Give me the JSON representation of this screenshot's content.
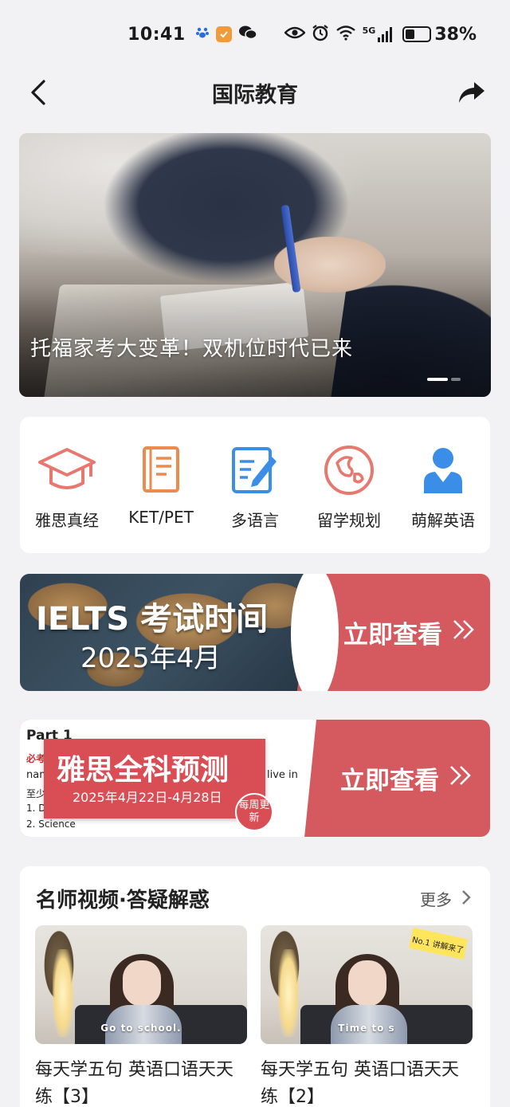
{
  "status_bar": {
    "time": "10:41",
    "network": "5G",
    "battery": "38%",
    "battery_level": 0.38
  },
  "nav": {
    "title": "国际教育"
  },
  "hero": {
    "caption": "托福家考大变革！双机位时代已来",
    "slide_count": 2,
    "active_slide": 1
  },
  "categories": [
    {
      "label": "雅思真经",
      "icon": "graduation-cap-icon",
      "color": "#e7786f"
    },
    {
      "label": "KET/PET",
      "icon": "book-icon",
      "color": "#ec8b4e"
    },
    {
      "label": "多语言",
      "icon": "edit-document-icon",
      "color": "#3a8ee8"
    },
    {
      "label": "留学规划",
      "icon": "globe-icon",
      "color": "#e7786f"
    },
    {
      "label": "萌解英语",
      "icon": "person-icon",
      "color": "#3a8ee8"
    }
  ],
  "promo_ielts": {
    "title": "IELTS 考试时间",
    "subtitle": "2025年4月",
    "cta": "立即查看",
    "cta_arrow": "»"
  },
  "promo_forecast": {
    "paper_heading": "Part 1",
    "paper_line1": "必考",
    "paper_line2": "nam",
    "paper_line2_right": "live in",
    "paper_line3": "至少",
    "paper_line4": "1. D",
    "paper_line5": "2. Science",
    "title": "雅思全科预测",
    "dates": "2025年4月22日-4月28日",
    "badge": "每周更新",
    "cta": "立即查看",
    "cta_arrow": "»"
  },
  "video_section": {
    "heading": "名师视频·答疑解惑",
    "more": "更多",
    "videos": [
      {
        "title": "每天学五句 英语口语天天练【3】",
        "thumb_caption": "Go to school.",
        "sticker": ""
      },
      {
        "title": "每天学五句 英语口语天天练【2】",
        "thumb_caption": "Time to s",
        "sticker": "No.1 讲解来了"
      }
    ]
  },
  "colors": {
    "accent_red": "#d45a5f",
    "icon_blue": "#3a8ee8",
    "icon_orange": "#ec8b4e",
    "icon_salmon": "#e7786f",
    "page_bg": "#f2f2f4"
  }
}
